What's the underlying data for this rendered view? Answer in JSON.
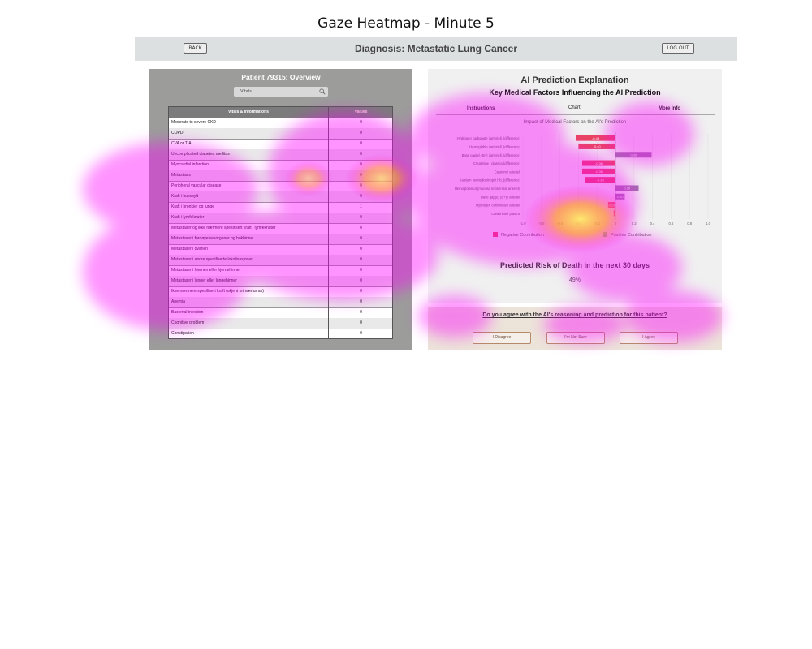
{
  "figure_title": "Gaze Heatmap - Minute 5",
  "header": {
    "back_label": "BACK",
    "title": "Diagnosis: Metastatic Lung Cancer",
    "logout_label": "LOG OUT"
  },
  "patient_panel": {
    "title": "Patient 79315: Overview",
    "search_category": "Vitals",
    "search_placeholder": "...",
    "columns": [
      "Vitals & Informations",
      "Values"
    ],
    "rows": [
      [
        "Moderate to severe CKD",
        "0"
      ],
      [
        "COPD",
        "0"
      ],
      [
        "CVA or TIA",
        "0"
      ],
      [
        "Uncomplicated diabetes mellitus",
        "0"
      ],
      [
        "Myocardial infarction",
        "0"
      ],
      [
        "Metastasis",
        "0"
      ],
      [
        "Peripheral vascular disease",
        "0"
      ],
      [
        "Kraft i bukspytt",
        "0"
      ],
      [
        "Kraft i bronkier og lunge",
        "1"
      ],
      [
        "Kraft i lymfeknuter",
        "0"
      ],
      [
        "Metastaser og ikke nærmere spesifisert kraft i lymfeknuter",
        "0"
      ],
      [
        "Metastaser i fordøyelsesorganer og bukhinne",
        "0"
      ],
      [
        "Metastaser i ovarien",
        "0"
      ],
      [
        "Metastaser i andre spesifiserte lokalisasjoner",
        "0"
      ],
      [
        "Metastaser i hjernen eller hjernehinner",
        "0"
      ],
      [
        "Metastaser i lunger eller lungehinner",
        "0"
      ],
      [
        "Ikke nærmere spesifisert kraft (ukjent primærtumor)",
        "0"
      ],
      [
        "Anemia",
        "0"
      ],
      [
        "Bacterial infection",
        "0"
      ],
      [
        "Cognitive problem",
        "0"
      ],
      [
        "Constipation",
        "0"
      ]
    ]
  },
  "ai_panel": {
    "title": "AI Prediction Explanation",
    "subtitle": "Key Medical Factors Influencing the AI Prediction",
    "tabs": [
      "Instructions",
      "Chart",
      "More Info"
    ],
    "chart_title": "Impact of Medical Factors on the AI's Prediction",
    "risk_title": "Predicted Risk of Death in the next 30 days",
    "risk_value": "49%"
  },
  "agreement": {
    "question": "Do you agree with the AI's reasoning and prediction for this patient?",
    "buttons": [
      "I Disagree",
      "I'm Not Sure",
      "I Agree"
    ]
  },
  "chart_data": {
    "type": "bar",
    "title": "Impact of Medical Factors on the AI's Prediction",
    "categories": [
      "Hydrogen carbonate i arteriell, (difference)",
      "Hemoglobin i arteriell, (difference)",
      "Base gap(e) (B+) i arteriell, (difference)",
      "Creatinine i plasma (difference)",
      "Calsium i arteriell",
      "Kalsium hemoglobinopi i Hb, (difference)",
      "Hemoglobin ut (mucosa konsentrat arteriell)",
      "Base gap(e) (B+) i arteriell",
      "Hydrogen carbonate i arteriell",
      "Creatinine i plasma"
    ],
    "values": [
      -0.43,
      -0.4,
      0.39,
      -0.36,
      -0.36,
      -0.33,
      0.25,
      0.1,
      -0.08,
      -0.02
    ],
    "value_labels": [
      "-0.43",
      "-0.40",
      "0.39",
      "-0.36",
      "-0.36",
      "-0.33",
      "0.25",
      "0.10",
      "-0.08",
      "-0.02"
    ],
    "x_ticks": [
      "-1.0",
      "-0.8",
      "-0.6",
      "-0.4",
      "-0.2",
      "0",
      "0.2",
      "0.4",
      "0.6",
      "0.8",
      "1.0"
    ],
    "xlim": [
      -1,
      1
    ],
    "legend": [
      "Negative Contribution",
      "Positive Contribution"
    ],
    "colors": {
      "negative": "#e84560",
      "positive": "#9a78a6"
    }
  },
  "heatmap": {
    "colors": {
      "low": "#ff00ff",
      "mid": "#ffb000",
      "high": "#ffff50"
    }
  }
}
